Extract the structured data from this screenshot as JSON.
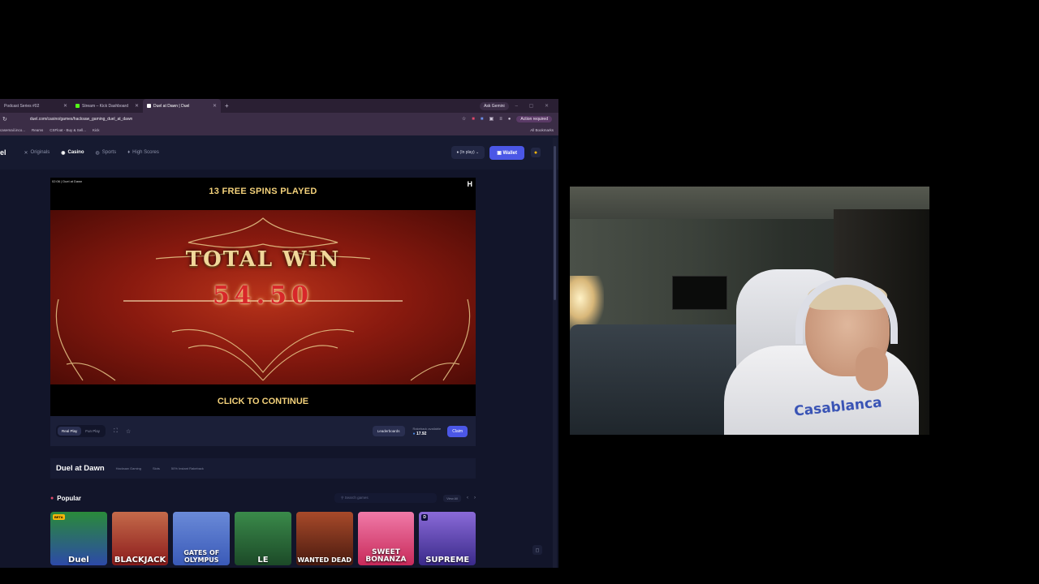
{
  "browser": {
    "tabs": [
      {
        "label": "Podcast Series #02",
        "active": false
      },
      {
        "label": "Stream – Kick Dashboard",
        "active": false
      },
      {
        "label": "Duel at Dawn | Duel",
        "active": true
      }
    ],
    "new_tab": "+",
    "gemini_label": "Ask Gemini",
    "window_controls": "– ▢ ✕",
    "url": "duel.com/casino/games/hacksaw_gaming_duel_at_dawn",
    "action_required": "Action required",
    "bookmarks": [
      "casemail.inco...",
      "Reams",
      "CSFloat - Buy & Sell...",
      "Kick"
    ],
    "all_bookmarks": "All Bookmarks"
  },
  "site": {
    "logo": "el",
    "nav": [
      {
        "label": "Originals",
        "icon": "originals-icon",
        "active": false
      },
      {
        "label": "Casino",
        "icon": "casino-icon",
        "active": true
      },
      {
        "label": "Sports",
        "icon": "sports-icon",
        "active": false
      },
      {
        "label": "High Scores",
        "icon": "trophy-icon",
        "active": false
      }
    ],
    "in_play": "(In play)",
    "wallet": "Wallet"
  },
  "game": {
    "tag": "02:06 | Duel at Dawn",
    "provider_mark": "H",
    "free_spins": "13 FREE SPINS PLAYED",
    "total_win_label": "TOTAL WIN",
    "total_win_amount": "54.50",
    "continue": "CLICK TO CONTINUE"
  },
  "controls": {
    "real_play": "Real Play",
    "fun_play": "Fun Play",
    "leaderboards": "Leaderboards",
    "rakeback_label": "Rakeback available",
    "rakeback_value": "17.92",
    "claim": "Claim"
  },
  "info": {
    "title": "Duel at Dawn",
    "chips": [
      "Hacksaw Gaming",
      "Slots",
      "50% Instant Rakeback"
    ]
  },
  "popular": {
    "label": "Popular",
    "search_placeholder": "Search games",
    "view_all": "View All",
    "games": [
      {
        "name": "Duel",
        "badge": "BETA",
        "bg": "#2d4aa8"
      },
      {
        "name": "BLACKJACK",
        "badge": "",
        "bg": "#8c1c1c"
      },
      {
        "name": "GATES OF OLYMPUS",
        "badge": "",
        "bg": "#3a5ab8"
      },
      {
        "name": "LE",
        "badge": "",
        "bg": "#2c6a3a"
      },
      {
        "name": "WANTED DEAD",
        "badge": "",
        "bg": "#6b2a18"
      },
      {
        "name": "SWEET BONANZA",
        "badge": "",
        "bg": "#d8407a"
      },
      {
        "name": "SUPREME",
        "badge": "D",
        "bg": "#5d3aa8"
      }
    ]
  },
  "webcam": {
    "shirt_text": "Casablanca"
  },
  "colors": {
    "accent": "#4b57e6",
    "gold": "#f3d17a",
    "banner_red": "#b8331a"
  }
}
